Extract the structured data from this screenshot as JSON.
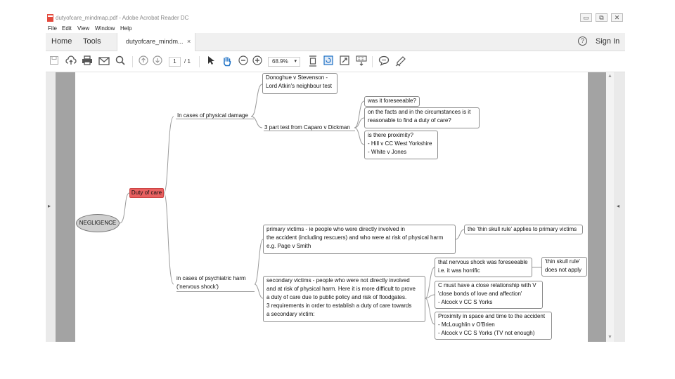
{
  "window": {
    "title": "dutyofcare_mindmap.pdf - Adobe Acrobat Reader DC",
    "controls": [
      "▭",
      "⧉",
      "✕"
    ]
  },
  "menu": [
    "File",
    "Edit",
    "View",
    "Window",
    "Help"
  ],
  "nav": {
    "home": "Home",
    "tools": "Tools"
  },
  "tab": {
    "name": "dutyofcare_mindm...",
    "close": "×"
  },
  "header": {
    "help": "?",
    "sign_in": "Sign In"
  },
  "toolbar": {
    "page_current": "1",
    "page_total": "/ 1",
    "zoom": "68.9%",
    "zoom_dropdown": "▾",
    "icons": [
      "save-icon",
      "upload-icon",
      "print-icon",
      "email-icon",
      "search-icon",
      "previous-page-icon",
      "next-page-icon",
      "select-cursor-icon",
      "hand-tool-icon",
      "zoom-out-icon",
      "zoom-in-icon",
      "fit-page-icon",
      "rotate-view-icon",
      "full-screen-icon",
      "keyboard-icon",
      "comment-icon",
      "sign-icon"
    ]
  },
  "panels": {
    "left_arrow": "▸",
    "right_arrow": "◂",
    "scroll_up": "▲",
    "scroll_down": "▼"
  },
  "mindmap": {
    "root": "NEGLIGENCE",
    "duty": "Duty of care",
    "physical": "In cases of physical damage",
    "donoghue": [
      "Donoghue v Stevenson -",
      "Lord Atkin's neighbour test"
    ],
    "caparo": "3 part test from Caparo v Dickman",
    "foreseeable": "was it foreseeable?",
    "reasonable": [
      "on the facts and in the circumstances is it",
      "reasonable to find a duty of care?"
    ],
    "proximity": [
      "is there proximity?",
      "- Hill v CC West Yorkshire",
      "- White v Jones"
    ],
    "psychiatric": [
      "in cases of psychiatric harm",
      "('nervous shock')"
    ],
    "primary": [
      "primary victims - ie people who were directly involved in",
      "the accident (including rescuers) and who were at risk of physical harm",
      "e.g. Page v Smith"
    ],
    "thin_skull_primary": "the 'thin skull rule' applies to primary victims",
    "secondary": [
      "secondary victims - people who were not directly involved",
      "and at risk of physical harm. Here it is more difficult to prove",
      "a duty of care due to public policy and risk of floodgates.",
      "3 requirements in order to establish a duty of care towards",
      "a secondary victim:"
    ],
    "shock": [
      "that nervous shock was foreseeable",
      "i.e. it was horrific"
    ],
    "thin_skull_secondary": [
      "'thin skull rule'",
      "does not apply"
    ],
    "relationship": [
      "C must have a close relationship with V",
      "'close bonds of love and affection'",
      "- Alcock v CC S Yorks"
    ],
    "space_time": [
      "Proximity in space and time to the accident",
      "- McLoughlin v O'Brien",
      "- Alcock v CC S Yorks (TV not enough)"
    ]
  }
}
